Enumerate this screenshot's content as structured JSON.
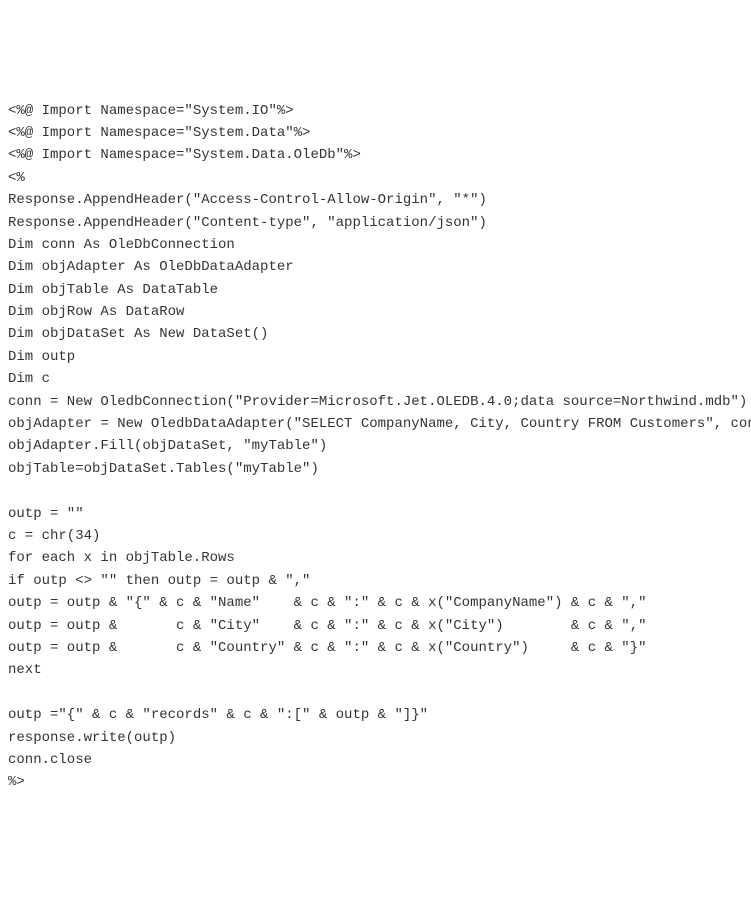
{
  "code": {
    "lines": [
      "<%@ Import Namespace=\"System.IO\"%>",
      "<%@ Import Namespace=\"System.Data\"%>",
      "<%@ Import Namespace=\"System.Data.OleDb\"%>",
      "<%",
      "Response.AppendHeader(\"Access-Control-Allow-Origin\", \"*\")",
      "Response.AppendHeader(\"Content-type\", \"application/json\")",
      "Dim conn As OleDbConnection",
      "Dim objAdapter As OleDbDataAdapter",
      "Dim objTable As DataTable",
      "Dim objRow As DataRow",
      "Dim objDataSet As New DataSet()",
      "Dim outp",
      "Dim c",
      "conn = New OledbConnection(\"Provider=Microsoft.Jet.OLEDB.4.0;data source=Northwind.mdb\")",
      "objAdapter = New OledbDataAdapter(\"SELECT CompanyName, City, Country FROM Customers\", conn)",
      "objAdapter.Fill(objDataSet, \"myTable\")",
      "objTable=objDataSet.Tables(\"myTable\")",
      "",
      "outp = \"\"",
      "c = chr(34)",
      "for each x in objTable.Rows",
      "if outp <> \"\" then outp = outp & \",\"",
      "outp = outp & \"{\" & c & \"Name\"    & c & \":\" & c & x(\"CompanyName\") & c & \",\"",
      "outp = outp &       c & \"City\"    & c & \":\" & c & x(\"City\")        & c & \",\"",
      "outp = outp &       c & \"Country\" & c & \":\" & c & x(\"Country\")     & c & \"}\"",
      "next",
      "",
      "outp =\"{\" & c & \"records\" & c & \":[\" & outp & \"]}\"",
      "response.write(outp)",
      "conn.close",
      "%>"
    ]
  }
}
